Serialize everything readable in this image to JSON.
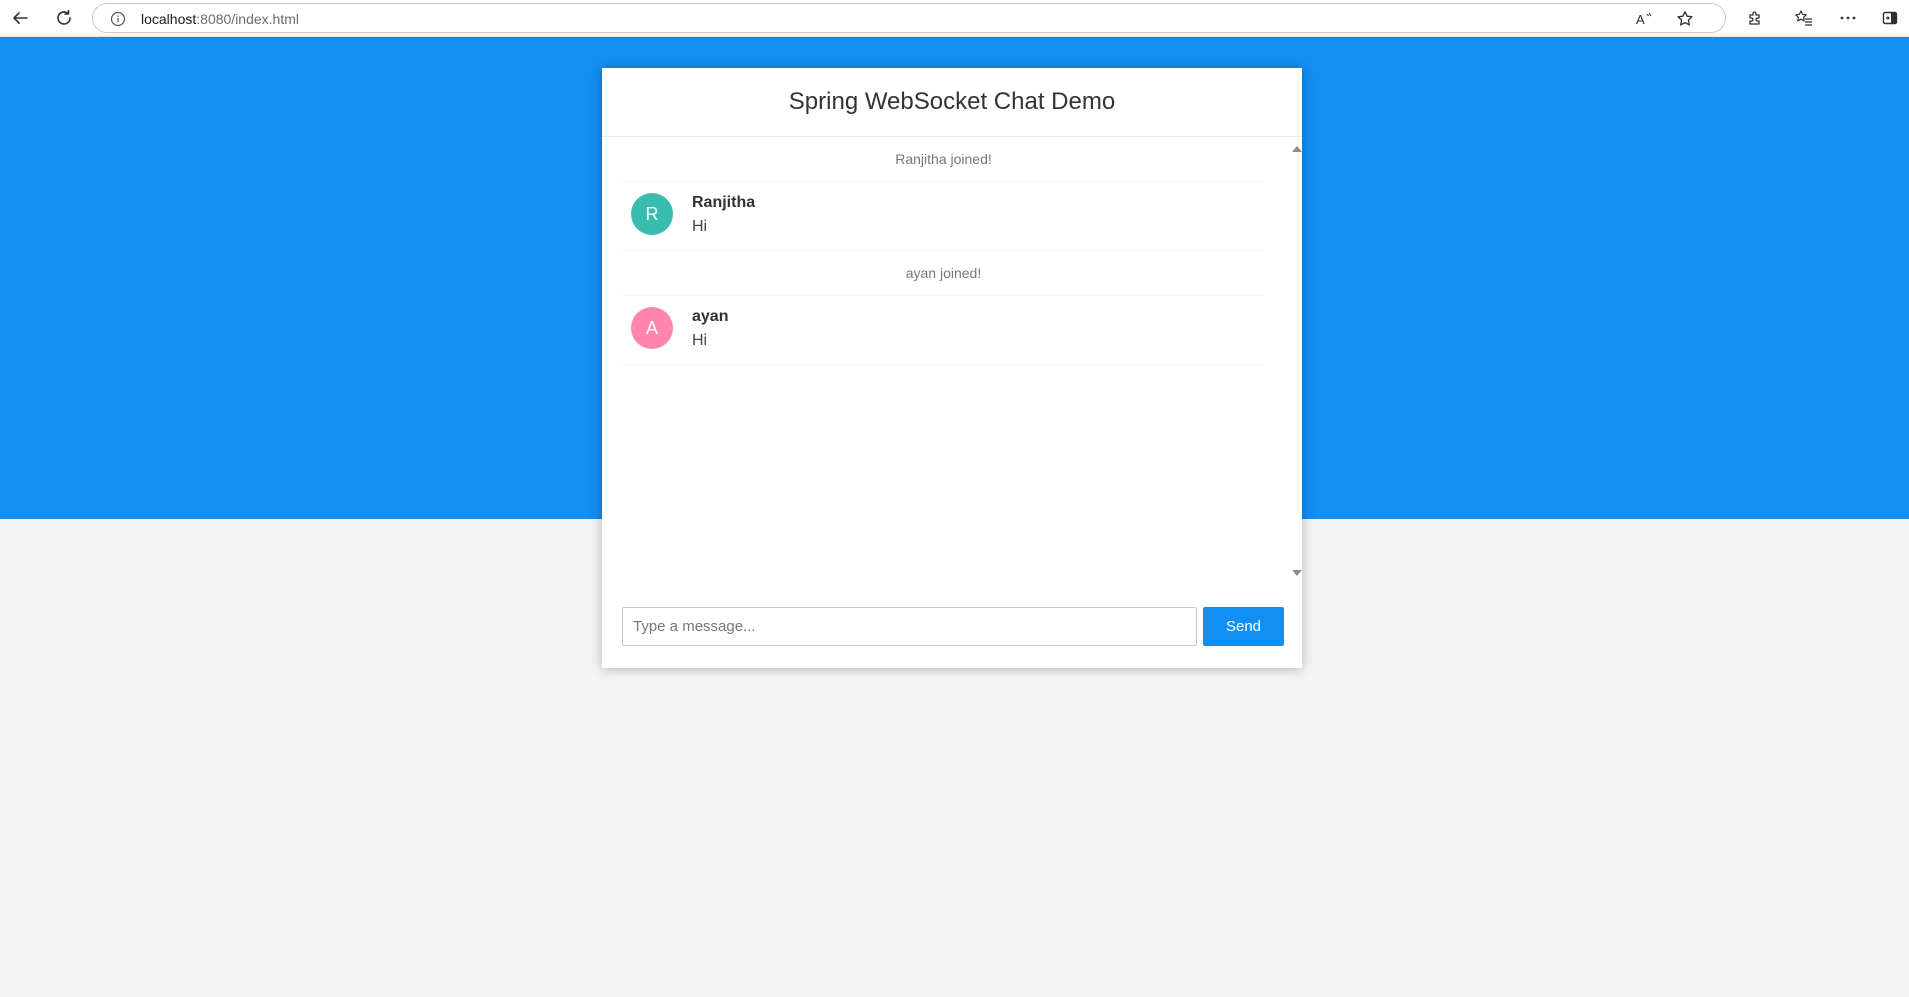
{
  "browser": {
    "url_host": "localhost",
    "url_rest": ":8080/index.html"
  },
  "chat": {
    "title": "Spring WebSocket Chat Demo",
    "messages": [
      {
        "type": "JOIN",
        "content": "Ranjitha joined!"
      },
      {
        "type": "CHAT",
        "sender": "Ranjitha",
        "avatar_letter": "R",
        "avatar_color": "#39bbb0",
        "content": "Hi"
      },
      {
        "type": "JOIN",
        "content": "ayan joined!"
      },
      {
        "type": "CHAT",
        "sender": "ayan",
        "avatar_letter": "A",
        "avatar_color": "#ff85af",
        "content": "Hi"
      }
    ],
    "input": {
      "placeholder": "Type a message...",
      "value": ""
    },
    "send_label": "Send"
  },
  "colors": {
    "primary": "#128ff2",
    "page_background": "#f4f4f4"
  },
  "icons": [
    "back-arrow-icon",
    "refresh-icon",
    "info-icon",
    "read-aloud-icon",
    "favorite-star-icon",
    "extensions-icon",
    "favorites-icon",
    "more-options-icon",
    "sidebar-toggle-icon"
  ]
}
